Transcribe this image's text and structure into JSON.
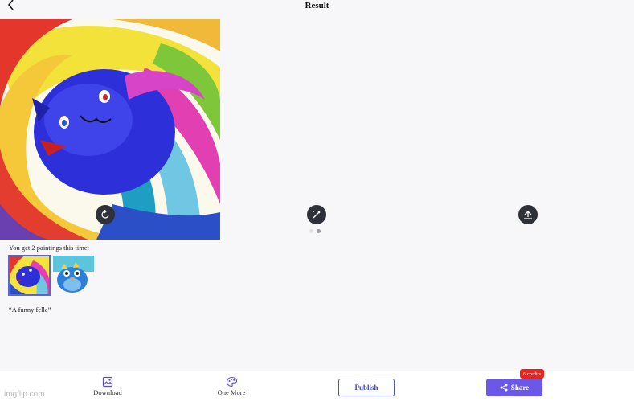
{
  "header": {
    "title": "Result"
  },
  "icons": {
    "back": "chevron-left-icon",
    "regenerate": "refresh-icon",
    "edit": "magic-wand-icon",
    "upload": "upload-icon",
    "download": "image-icon",
    "one_more": "palette-icon",
    "share": "share-icon"
  },
  "carousel": {
    "pages": 2,
    "active_page": 1
  },
  "result": {
    "count_text": "You get 2 paintings this time:",
    "thumbnails": [
      "painting-1",
      "painting-2"
    ],
    "selected_thumbnail": 1,
    "prompt": "“A funny fella”"
  },
  "bottom_bar": {
    "download_label": "Download",
    "one_more_label": "One More",
    "publish_label": "Publish",
    "share_label": "Share",
    "credits_badge": "6 credits"
  },
  "watermark": "imgflip.com",
  "colors": {
    "accent": "#6a58e6",
    "publish_border": "#4d52c3",
    "badge": "#e8231f",
    "background": "#f7f7f9"
  }
}
